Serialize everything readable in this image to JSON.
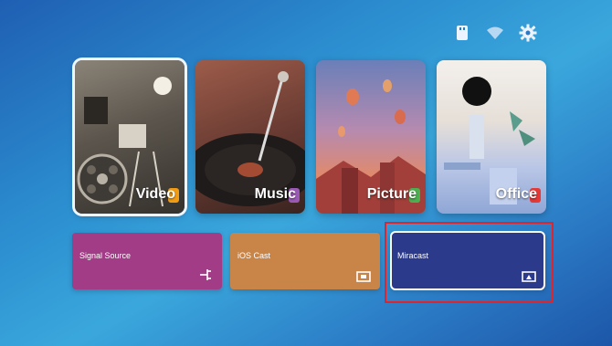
{
  "status_bar": {
    "icons": [
      "usb-drive-icon",
      "wifi-icon",
      "settings-gear-icon"
    ]
  },
  "media_cards": [
    {
      "label": "Video",
      "icon": "film-reel-icon",
      "badge_color": "#f39c12",
      "selected": true
    },
    {
      "label": "Music",
      "icon": "vinyl-record-icon",
      "badge_color": "#9b59b6",
      "selected": false
    },
    {
      "label": "Picture",
      "icon": "landscape-icon",
      "badge_color": "#4caf50",
      "selected": false
    },
    {
      "label": "Office",
      "icon": "document-icon",
      "badge_color": "#e53935",
      "selected": false
    }
  ],
  "tiles": [
    {
      "label": "Signal Source",
      "color": "#a23c86",
      "icon": "input-source-icon"
    },
    {
      "label": "iOS Cast",
      "color": "#c98548",
      "icon": "screen-cast-icon"
    },
    {
      "label": "Miracast",
      "color": "#2c3a8c",
      "icon": "miracast-icon",
      "focused": true
    }
  ],
  "colors": {
    "highlight_box": "#e0242b",
    "focus_ring": "#ffffff"
  }
}
